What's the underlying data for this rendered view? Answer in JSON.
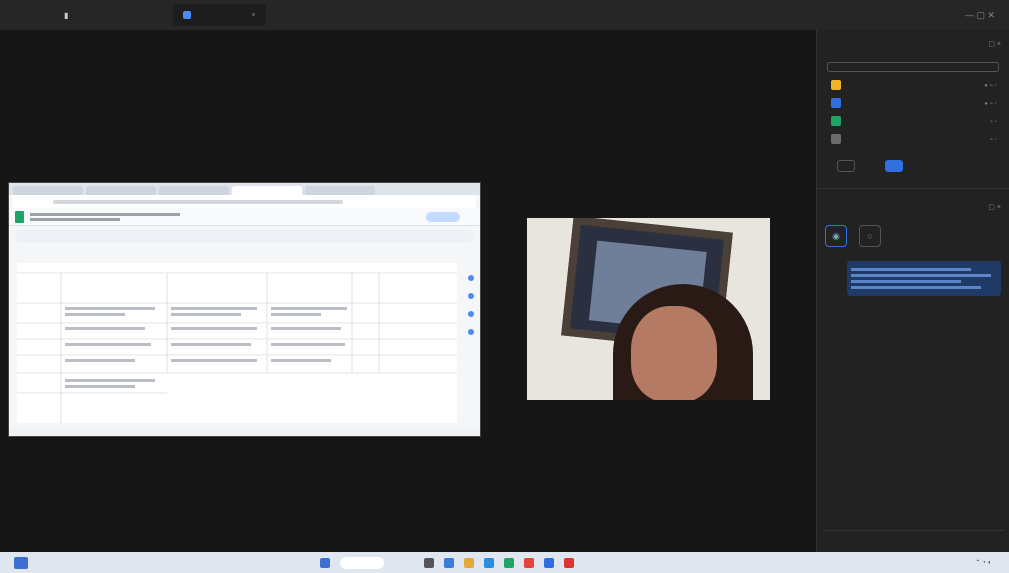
{
  "app": {
    "logo_lines": [
      "",
      ""
    ],
    "tabs": [
      {
        "label": ""
      },
      {
        "label": ""
      }
    ]
  },
  "participants": {
    "title": "",
    "search_placeholder": "",
    "list": [
      {
        "name": "",
        "color": "#f0b429"
      },
      {
        "name": "",
        "color": "#2f6fe0"
      },
      {
        "name": "",
        "color": "#1fa463"
      },
      {
        "name": "",
        "color": "#6b6b6b"
      }
    ],
    "invite_label": "",
    "more_label": ""
  },
  "chat": {
    "title": "",
    "message": "",
    "system_lines": [
      "",
      "",
      ""
    ]
  },
  "video": {
    "name_tag": ""
  },
  "taskbar": {
    "search_label": "",
    "clock": ""
  },
  "colors": {
    "accent": "#2f6fe0",
    "panel_bg": "#222222",
    "stage_bg": "#161616"
  }
}
